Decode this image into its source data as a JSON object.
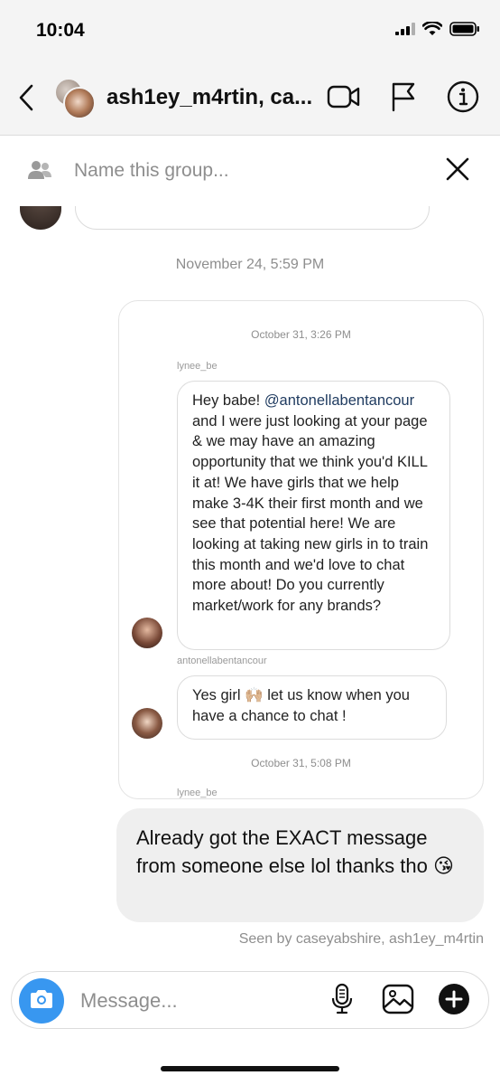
{
  "status_bar": {
    "time": "10:04",
    "icons": [
      "signal-icon",
      "wifi-icon",
      "battery-icon"
    ]
  },
  "header": {
    "title": "ash1ey_m4rtin, ca...",
    "icons": [
      "back-chevron-icon",
      "video-call-icon",
      "flag-icon",
      "info-icon"
    ]
  },
  "group_bar": {
    "placeholder": "Name this group...",
    "icons": [
      "group-people-icon",
      "close-icon"
    ]
  },
  "thread": {
    "date_separator": "November 24, 5:59 PM",
    "shared_card": {
      "timestamp_1": "October 31, 3:26 PM",
      "user_1": "lynee_be",
      "message_1_mention": "@antonellabentancour",
      "message_1_text": "and I were just looking at your page & we may have an amazing opportunity that we think you'd KILL it at! We have girls that we help make 3-4K their first month and we see that potential here! We are looking at taking new girls in to train this month and we'd love to chat more about! Do you currently market/work for any brands?",
      "message_1_prefix": "Hey babe! ",
      "user_2": "antonellabentancour",
      "message_2_text": "Yes girl 🙌🏼 let us know when you have a chance to chat !",
      "timestamp_2": "October 31, 5:08 PM",
      "user_3": "lynee_be"
    },
    "my_message": "Already got the EXACT message from someone else lol thanks tho 😘",
    "seen_by": "Seen by caseyabshire, ash1ey_m4rtin"
  },
  "composer": {
    "placeholder": "Message...",
    "icons": [
      "camera-icon",
      "microphone-icon",
      "gallery-icon",
      "plus-icon"
    ],
    "accent_color": "#3897f0"
  }
}
